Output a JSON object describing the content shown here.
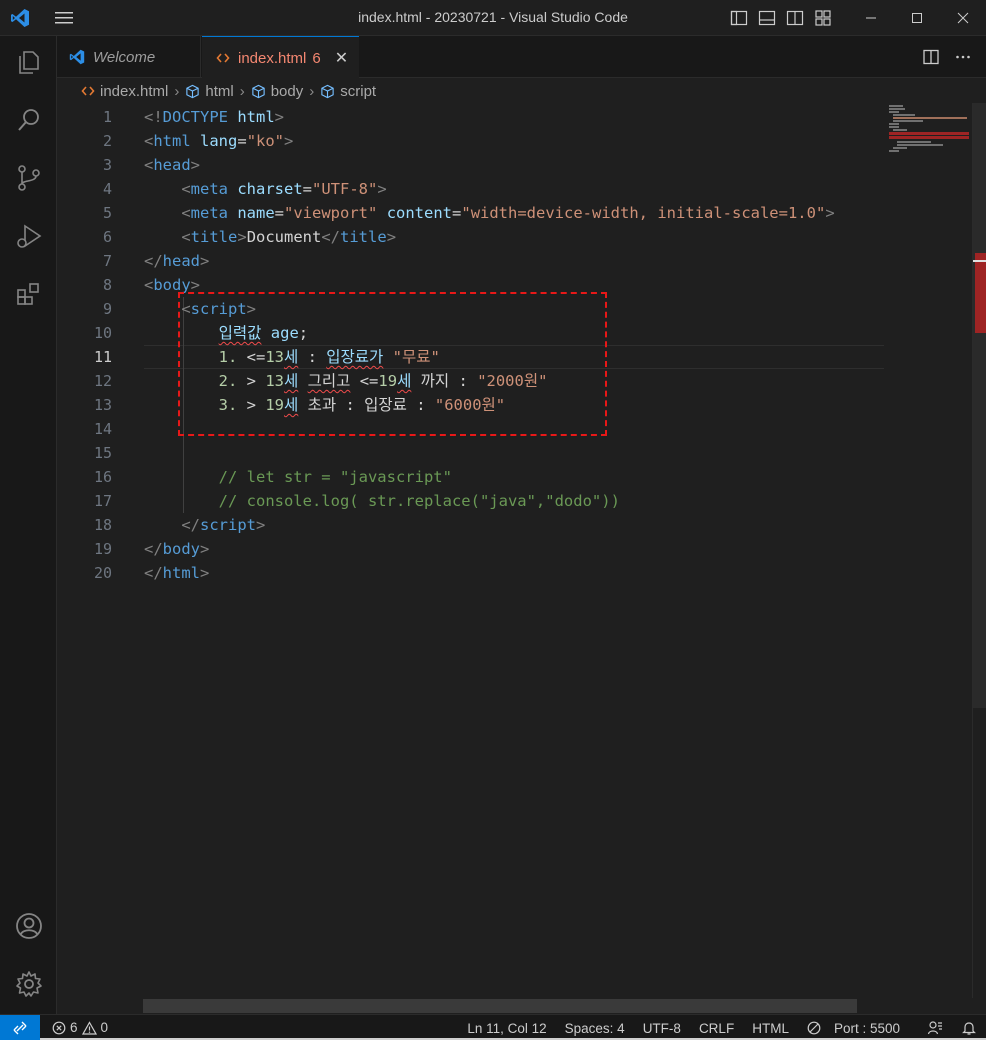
{
  "window": {
    "title": "index.html - 20230721 - Visual Studio Code"
  },
  "tabs": [
    {
      "label": "Welcome",
      "icon": "vscode-logo-icon"
    },
    {
      "label": "index.html",
      "problem_count": "6",
      "icon": "html-file-icon"
    }
  ],
  "breadcrumb": [
    "index.html",
    "html",
    "body",
    "script"
  ],
  "editor": {
    "active_line": 11,
    "lines": [
      [
        {
          "c": "t-punc",
          "t": "<!"
        },
        {
          "c": "t-tag",
          "t": "DOCTYPE"
        },
        {
          "c": "t-text",
          "t": " "
        },
        {
          "c": "t-attr",
          "t": "html"
        },
        {
          "c": "t-punc",
          "t": ">"
        }
      ],
      [
        {
          "c": "t-punc",
          "t": "<"
        },
        {
          "c": "t-tag",
          "t": "html"
        },
        {
          "c": "t-text",
          "t": " "
        },
        {
          "c": "t-attr",
          "t": "lang"
        },
        {
          "c": "t-text",
          "t": "="
        },
        {
          "c": "t-str",
          "t": "\"ko\""
        },
        {
          "c": "t-punc",
          "t": ">"
        }
      ],
      [
        {
          "c": "t-punc",
          "t": "<"
        },
        {
          "c": "t-tag",
          "t": "head"
        },
        {
          "c": "t-punc",
          "t": ">"
        }
      ],
      [
        {
          "c": "t-text",
          "t": "    "
        },
        {
          "c": "t-punc",
          "t": "<"
        },
        {
          "c": "t-tag",
          "t": "meta"
        },
        {
          "c": "t-text",
          "t": " "
        },
        {
          "c": "t-attr",
          "t": "charset"
        },
        {
          "c": "t-text",
          "t": "="
        },
        {
          "c": "t-str",
          "t": "\"UTF-8\""
        },
        {
          "c": "t-punc",
          "t": ">"
        }
      ],
      [
        {
          "c": "t-text",
          "t": "    "
        },
        {
          "c": "t-punc",
          "t": "<"
        },
        {
          "c": "t-tag",
          "t": "meta"
        },
        {
          "c": "t-text",
          "t": " "
        },
        {
          "c": "t-attr",
          "t": "name"
        },
        {
          "c": "t-text",
          "t": "="
        },
        {
          "c": "t-str",
          "t": "\"viewport\""
        },
        {
          "c": "t-text",
          "t": " "
        },
        {
          "c": "t-attr",
          "t": "content"
        },
        {
          "c": "t-text",
          "t": "="
        },
        {
          "c": "t-str",
          "t": "\"width=device-width, initial-scale=1.0\""
        },
        {
          "c": "t-punc",
          "t": ">"
        }
      ],
      [
        {
          "c": "t-text",
          "t": "    "
        },
        {
          "c": "t-punc",
          "t": "<"
        },
        {
          "c": "t-tag",
          "t": "title"
        },
        {
          "c": "t-punc",
          "t": ">"
        },
        {
          "c": "t-text",
          "t": "Document"
        },
        {
          "c": "t-punc",
          "t": "</"
        },
        {
          "c": "t-tag",
          "t": "title"
        },
        {
          "c": "t-punc",
          "t": ">"
        }
      ],
      [
        {
          "c": "t-punc",
          "t": "</"
        },
        {
          "c": "t-tag",
          "t": "head"
        },
        {
          "c": "t-punc",
          "t": ">"
        }
      ],
      [
        {
          "c": "t-punc",
          "t": "<"
        },
        {
          "c": "t-tag",
          "t": "body"
        },
        {
          "c": "t-punc",
          "t": ">"
        }
      ],
      [
        {
          "c": "t-text",
          "t": "    "
        },
        {
          "c": "t-punc",
          "t": "<"
        },
        {
          "c": "t-tag",
          "t": "script"
        },
        {
          "c": "t-punc",
          "t": ">"
        }
      ],
      [
        {
          "c": "t-text",
          "t": "        "
        },
        {
          "c": "t-var squig",
          "t": "입력값"
        },
        {
          "c": "t-text",
          "t": " "
        },
        {
          "c": "t-var",
          "t": "age"
        },
        {
          "c": "t-text",
          "t": ";"
        }
      ],
      [
        {
          "c": "t-text",
          "t": "        "
        },
        {
          "c": "t-num",
          "t": "1."
        },
        {
          "c": "t-text",
          "t": " <="
        },
        {
          "c": "t-num",
          "t": "13"
        },
        {
          "c": "t-var squig",
          "t": "세"
        },
        {
          "c": "t-text",
          "t": " : "
        },
        {
          "c": "t-var squig",
          "t": "입장료가"
        },
        {
          "c": "t-text",
          "t": " "
        },
        {
          "c": "t-str",
          "t": "\"무료\""
        }
      ],
      [
        {
          "c": "t-text",
          "t": "        "
        },
        {
          "c": "t-num",
          "t": "2."
        },
        {
          "c": "t-text",
          "t": " > "
        },
        {
          "c": "t-num",
          "t": "13"
        },
        {
          "c": "t-var squig",
          "t": "세"
        },
        {
          "c": "t-text",
          "t": " "
        },
        {
          "c": "t-kor squig",
          "t": "그리고"
        },
        {
          "c": "t-text",
          "t": " <="
        },
        {
          "c": "t-num",
          "t": "19"
        },
        {
          "c": "t-var squig",
          "t": "세"
        },
        {
          "c": "t-text",
          "t": " 까지 : "
        },
        {
          "c": "t-str",
          "t": "\"2000원\""
        }
      ],
      [
        {
          "c": "t-text",
          "t": "        "
        },
        {
          "c": "t-num",
          "t": "3."
        },
        {
          "c": "t-text",
          "t": " > "
        },
        {
          "c": "t-num",
          "t": "19"
        },
        {
          "c": "t-var squig",
          "t": "세"
        },
        {
          "c": "t-text",
          "t": " 초과 : 입장료 : "
        },
        {
          "c": "t-str",
          "t": "\"6000원\""
        }
      ],
      [
        {
          "c": "t-text",
          "t": ""
        }
      ],
      [
        {
          "c": "t-text",
          "t": ""
        }
      ],
      [
        {
          "c": "t-text",
          "t": "        "
        },
        {
          "c": "t-com",
          "t": "// let str = \"javascript\""
        }
      ],
      [
        {
          "c": "t-text",
          "t": "        "
        },
        {
          "c": "t-com",
          "t": "// console.log( str.replace(\"java\",\"dodo\"))"
        }
      ],
      [
        {
          "c": "t-text",
          "t": "    "
        },
        {
          "c": "t-punc",
          "t": "</"
        },
        {
          "c": "t-tag",
          "t": "script"
        },
        {
          "c": "t-punc",
          "t": ">"
        }
      ],
      [
        {
          "c": "t-punc",
          "t": "</"
        },
        {
          "c": "t-tag",
          "t": "body"
        },
        {
          "c": "t-punc",
          "t": ">"
        }
      ],
      [
        {
          "c": "t-punc",
          "t": "</"
        },
        {
          "c": "t-tag",
          "t": "html"
        },
        {
          "c": "t-punc",
          "t": ">"
        }
      ]
    ]
  },
  "statusbar": {
    "errors": "6",
    "warnings": "0",
    "position": "Ln 11, Col 12",
    "indent": "Spaces: 4",
    "encoding": "UTF-8",
    "eol": "CRLF",
    "language": "HTML",
    "port": "Port : 5500"
  },
  "colors": {
    "accent": "#0078d4",
    "annotation_box": "#e81818",
    "error": "#f14c4c"
  }
}
